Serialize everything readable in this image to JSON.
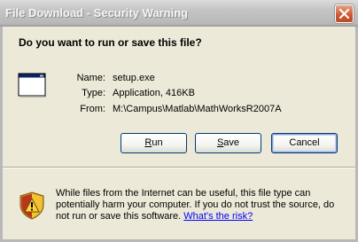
{
  "window": {
    "title": "File Download - Security Warning"
  },
  "dialog": {
    "question": "Do you want to run or save this file?",
    "file_info": {
      "name_label": "Name:",
      "name_value": "setup.exe",
      "type_label": "Type:",
      "type_value": "Application, 416KB",
      "from_label": "From:",
      "from_value": "M:\\Campus\\Matlab\\MathWorksR2007A"
    },
    "buttons": {
      "run_accel": "R",
      "run_rest": "un",
      "save_accel": "S",
      "save_rest": "ave",
      "cancel": "Cancel"
    },
    "warning": {
      "text": "While files from the Internet can be useful, this file type can potentially harm your computer. If you do not trust the source, do not run or save this software.",
      "link": "What's the risk?"
    }
  },
  "icons": {
    "close": "close-icon",
    "file": "application-window-icon",
    "warning": "security-shield-warning-icon"
  }
}
